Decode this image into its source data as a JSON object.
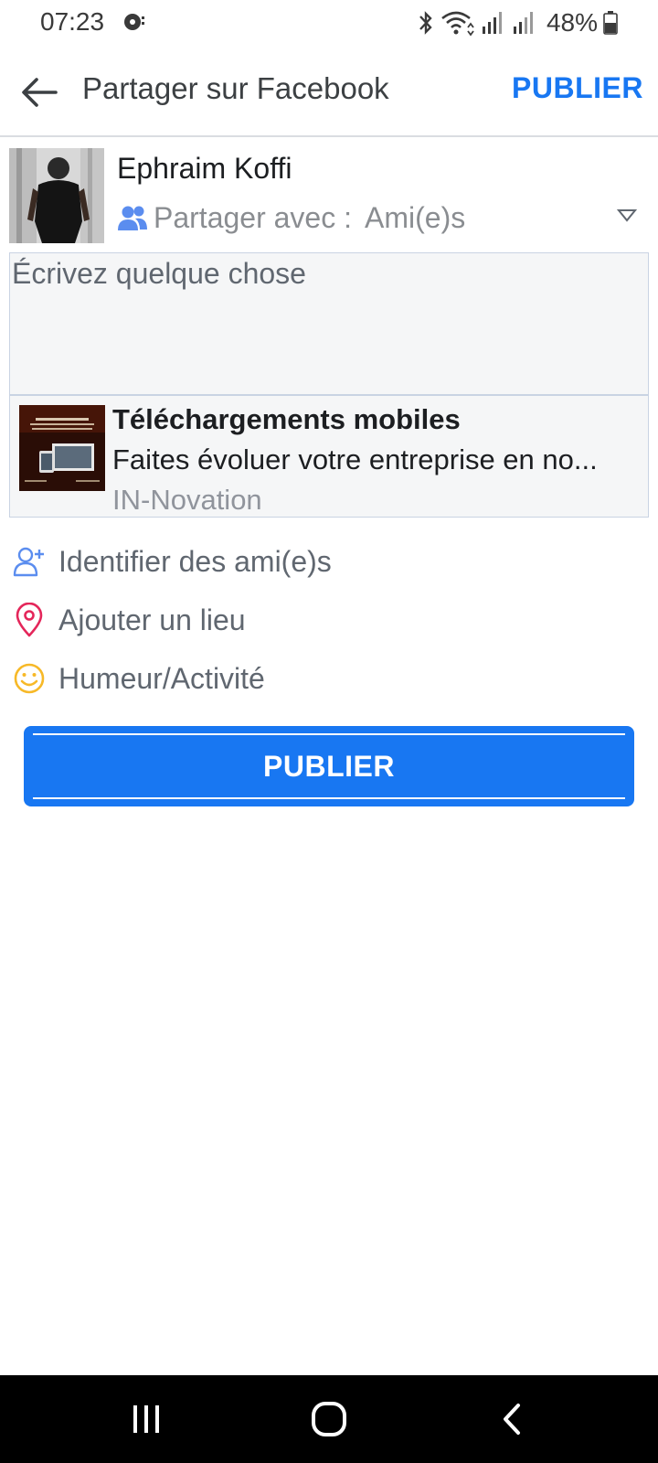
{
  "status_bar": {
    "time": "07:23",
    "battery": "48%"
  },
  "app_bar": {
    "title": "Partager sur Facebook",
    "publish_label": "PUBLIER"
  },
  "user": {
    "name": "Ephraim Koffi",
    "share_label": "Partager avec :",
    "share_value": "Ami(e)s"
  },
  "composer": {
    "placeholder": "Écrivez quelque chose",
    "value": ""
  },
  "link_preview": {
    "title": "Téléchargements mobiles",
    "description": "Faites évoluer votre entreprise en no...",
    "source": "IN-Novation"
  },
  "options": [
    {
      "icon": "tag-friends-icon",
      "label": "Identifier des ami(e)s"
    },
    {
      "icon": "location-pin-icon",
      "label": "Ajouter un lieu"
    },
    {
      "icon": "smiley-icon",
      "label": "Humeur/Activité"
    }
  ],
  "publish_button": {
    "label": "PUBLIER"
  },
  "colors": {
    "accent": "#1877f2",
    "location": "#e4265a",
    "mood": "#f7b928"
  }
}
